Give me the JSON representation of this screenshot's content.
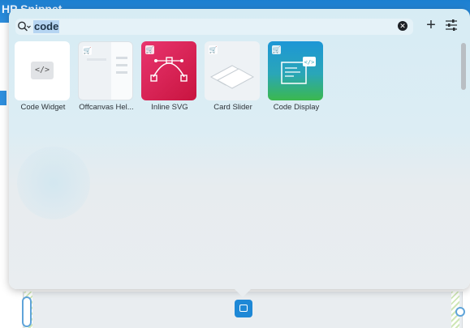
{
  "background": {
    "app_title": "HP Snippet"
  },
  "search": {
    "query": "code",
    "clear_symbol": "✕",
    "add_symbol": "+"
  },
  "icons": {
    "search": "search-icon",
    "clear": "clear-icon",
    "add": "plus-icon",
    "settings": "sliders-icon",
    "cart": "cart-icon"
  },
  "results": [
    {
      "label": "Code Widget",
      "premium": false
    },
    {
      "label": "Offcanvas Hel...",
      "premium": true
    },
    {
      "label": "Inline SVG",
      "premium": true
    },
    {
      "label": "Card Slider",
      "premium": true
    },
    {
      "label": "Code Display",
      "premium": true
    }
  ],
  "colors": {
    "accent": "#1e88d6",
    "inline_svg_tile": "#d81a4f",
    "code_display_tile": "#2aa6b8"
  }
}
